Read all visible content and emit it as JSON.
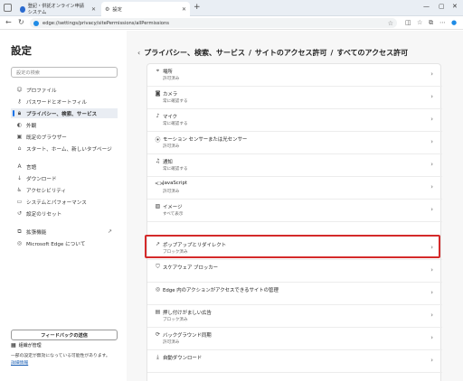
{
  "browser": {
    "tabs": [
      {
        "title": "登記・供託オンライン申請システム",
        "active": false
      },
      {
        "title": "設定",
        "active": true
      }
    ],
    "url": "edge://settings/privacy/sitePermissions/allPermissions"
  },
  "sidebar": {
    "title": "設定",
    "search_placeholder": "設定の検索",
    "items": [
      {
        "label": "プロファイル",
        "icon": "person-icon"
      },
      {
        "label": "パスワードとオートフィル",
        "icon": "key-icon"
      },
      {
        "label": "プライバシー、検索、サービス",
        "icon": "lock-icon",
        "active": true
      },
      {
        "label": "外観",
        "icon": "appearance-icon"
      },
      {
        "label": "既定のブラウザー",
        "icon": "browser-icon"
      },
      {
        "label": "スタート、ホーム、新しいタブページ",
        "icon": "home-icon"
      },
      {
        "label": "言語",
        "icon": "language-icon"
      },
      {
        "label": "ダウンロード",
        "icon": "download-icon"
      },
      {
        "label": "アクセシビリティ",
        "icon": "accessibility-icon"
      },
      {
        "label": "システムとパフォーマンス",
        "icon": "system-icon"
      },
      {
        "label": "設定のリセット",
        "icon": "reset-icon"
      },
      {
        "label": "拡張機能",
        "icon": "extensions-icon"
      },
      {
        "label": "Microsoft Edge について",
        "icon": "edge-icon"
      }
    ],
    "feedback_button": "フィードバックの送信",
    "managed_label": "組織が管理",
    "managed_desc": "一部の設定が無効になっている可能性があります。",
    "managed_link": "詳細情報"
  },
  "main": {
    "breadcrumb": [
      "プライバシー、検索、サービス",
      "サイトのアクセス許可",
      "すべてのアクセス許可"
    ],
    "permissions": [
      {
        "label": "場所",
        "status": "許可済み",
        "icon": "location-icon"
      },
      {
        "label": "カメラ",
        "status": "常に確認する",
        "icon": "camera-icon"
      },
      {
        "label": "マイク",
        "status": "常に確認する",
        "icon": "microphone-icon"
      },
      {
        "label": "モーション センサーまたは光センサー",
        "status": "許可済み",
        "icon": "sensor-icon"
      },
      {
        "label": "通知",
        "status": "常に確認する",
        "icon": "bell-icon"
      },
      {
        "label": "JavaScript",
        "status": "許可済み",
        "icon": "code-icon"
      },
      {
        "label": "イメージ",
        "status": "すべて表示",
        "icon": "image-icon"
      },
      {
        "label": "ポップアップとリダイレクト",
        "status": "ブロック済み",
        "icon": "popup-icon"
      },
      {
        "label": "スケアウェア ブロッカー",
        "status": "",
        "icon": "shield-icon"
      },
      {
        "label": "Edge 内のアクションがアクセスできるサイトの管理",
        "status": "",
        "icon": "edge-action-icon"
      },
      {
        "label": "押し付けがましい広告",
        "status": "ブロック済み",
        "icon": "ad-icon"
      },
      {
        "label": "バックグラウンド同期",
        "status": "許可済み",
        "icon": "sync-icon"
      },
      {
        "label": "自動ダウンロード",
        "status": "",
        "icon": "download-icon"
      }
    ]
  }
}
